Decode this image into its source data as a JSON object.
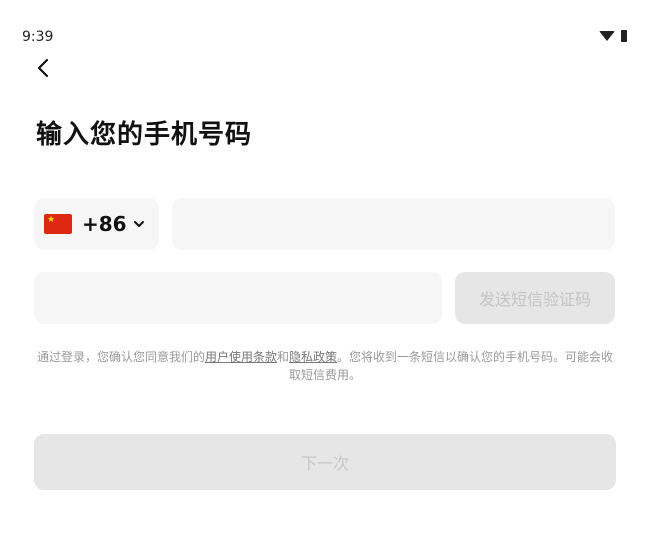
{
  "status_bar": {
    "time": "9:39"
  },
  "header": {
    "title": "输入您的手机号码"
  },
  "phone": {
    "country_code": "+86",
    "number_value": "",
    "flag_icon": "china-flag-icon"
  },
  "verification": {
    "code_value": "",
    "send_code_label": "发送短信验证码"
  },
  "terms": {
    "prefix": "通过登录，您确认您同意我们的",
    "user_terms_link": "用户使用条款",
    "and": "和",
    "privacy_link": "隐私政策",
    "suffix": "。您将收到一条短信以确认您的手机号码。可能会收取短信费用。"
  },
  "actions": {
    "next_label": "下一次"
  },
  "colors": {
    "background": "#ffffff",
    "field_bg": "#f6f6f6",
    "disabled_button_bg": "#e6e6e6",
    "disabled_text": "#c4c4c4",
    "flag_red": "#de2910"
  }
}
